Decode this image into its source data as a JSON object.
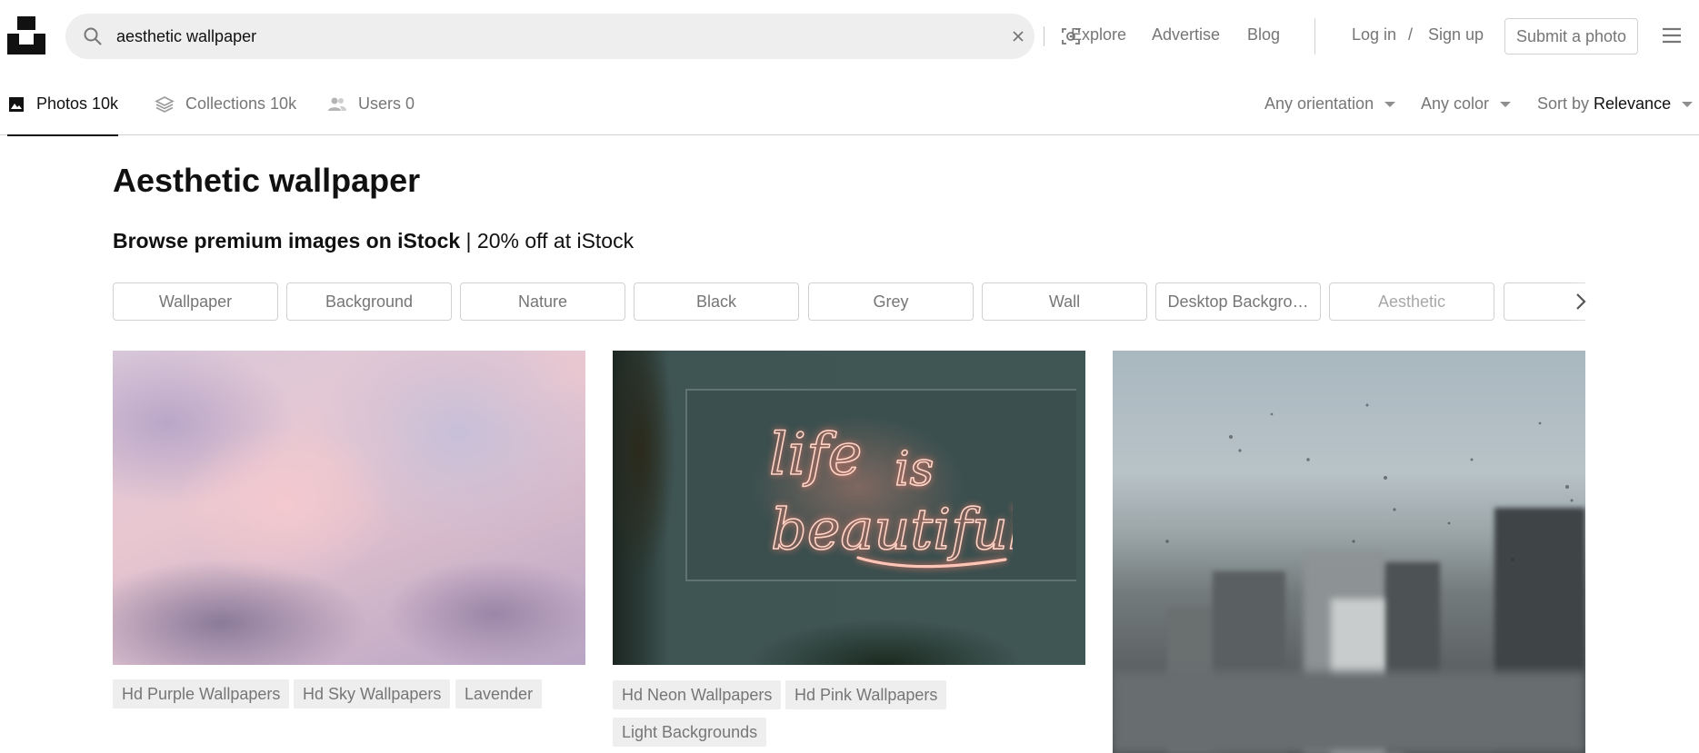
{
  "search": {
    "value": "aesthetic wallpaper",
    "placeholder": "Search photos and illustrations"
  },
  "nav": {
    "explore": "Explore",
    "advertise": "Advertise",
    "blog": "Blog",
    "login": "Log in",
    "slash": "/",
    "signup": "Sign up",
    "submit": "Submit a photo"
  },
  "tabs": [
    {
      "label": "Photos 10k"
    },
    {
      "label": "Collections 10k"
    },
    {
      "label": "Users 0"
    }
  ],
  "filters": {
    "orientation": "Any orientation",
    "color": "Any color",
    "sort_prefix": "Sort by",
    "sort_value": "Relevance"
  },
  "page": {
    "title": "Aesthetic wallpaper",
    "promo_bold": "Browse premium images on iStock",
    "promo_rest": " | 20% off at iStock"
  },
  "related": [
    "Wallpaper",
    "Background",
    "Nature",
    "Black",
    "Grey",
    "Wall",
    "Desktop Backgro…",
    "Aesthetic"
  ],
  "photos": [
    {
      "tags": [
        "Hd Purple Wallpapers",
        "Hd Sky Wallpapers",
        "Lavender"
      ]
    },
    {
      "tags": [
        "Hd Neon Wallpapers",
        "Hd Pink Wallpapers",
        "Light Backgrounds"
      ]
    },
    {
      "tags": []
    }
  ],
  "neon_text": {
    "line1": "life",
    "line2": "is",
    "line3": "beautiful"
  },
  "colors": {
    "accent": "#111111",
    "muted": "#767676",
    "chip_border": "#d1d1d1",
    "tag_bg": "#eeeeee"
  }
}
